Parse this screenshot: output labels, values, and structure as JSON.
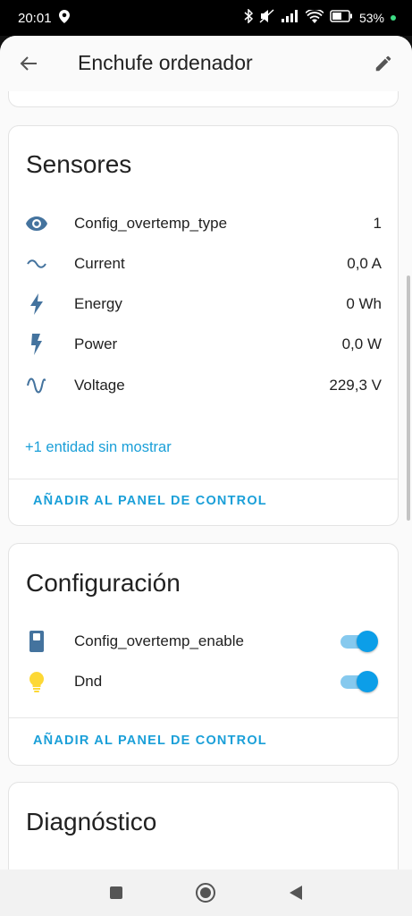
{
  "status_bar": {
    "time": "20:01",
    "battery": "53%"
  },
  "app_bar": {
    "title": "Enchufe ordenador"
  },
  "sensores": {
    "title": "Sensores",
    "items": [
      {
        "icon": "eye-icon",
        "label": "Config_overtemp_type",
        "value": "1"
      },
      {
        "icon": "current-wave-icon",
        "label": "Current",
        "value": "0,0 A"
      },
      {
        "icon": "lightning-icon",
        "label": "Energy",
        "value": "0 Wh"
      },
      {
        "icon": "power-flash-icon",
        "label": "Power",
        "value": "0,0 W"
      },
      {
        "icon": "sine-wave-icon",
        "label": "Voltage",
        "value": "229,3 V"
      }
    ],
    "more_link": "+1 entidad sin mostrar",
    "action": "AÑADIR AL PANEL DE CONTROL"
  },
  "configuracion": {
    "title": "Configuración",
    "items": [
      {
        "icon": "switch-icon",
        "label": "Config_overtemp_enable",
        "on": true
      },
      {
        "icon": "lightbulb-icon",
        "label": "Dnd",
        "on": true
      }
    ],
    "action": "AÑADIR AL PANEL DE CONTROL"
  },
  "diagnostico": {
    "title": "Diagnóstico"
  },
  "colors": {
    "accent": "#1a9fd8",
    "toggle_thumb": "#0c9ee8",
    "icon_blue": "#44739e",
    "bulb_yellow": "#fdd835"
  }
}
